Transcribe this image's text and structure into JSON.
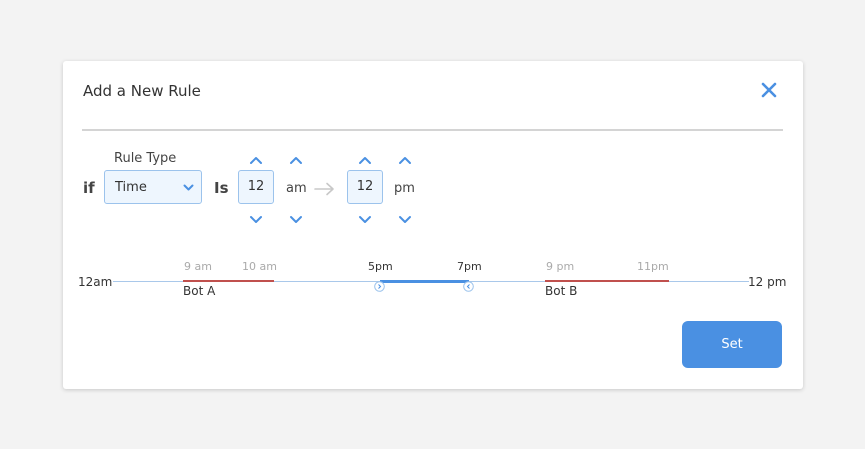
{
  "dialog": {
    "title": "Add a New Rule"
  },
  "rule": {
    "if_label": "if",
    "is_label": "Is",
    "rule_type_label": "Rule Type",
    "rule_type_value": "Time",
    "start": {
      "hour": "12",
      "period": "am"
    },
    "end": {
      "hour": "12",
      "period": "pm"
    }
  },
  "timeline": {
    "start_label": "12am",
    "end_label": "12 pm",
    "segments": [
      {
        "name": "Bot A",
        "from": "9 am",
        "to": "10 am",
        "color": "#c0504d"
      },
      {
        "name": "Bot B",
        "from": "9 pm",
        "to": "11pm",
        "color": "#c0504d"
      }
    ],
    "selection": {
      "from": "5pm",
      "to": "7pm",
      "color": "#4a90e2"
    }
  },
  "actions": {
    "set_label": "Set"
  },
  "colors": {
    "accent": "#4a90e2",
    "bot_segment": "#c0504d",
    "input_bg": "#eef6fe",
    "input_border": "#9cc3ec"
  },
  "icons": {
    "close": "close-icon",
    "up": "chevron-up-icon",
    "down": "chevron-down-icon",
    "arrow": "arrow-right-icon"
  }
}
